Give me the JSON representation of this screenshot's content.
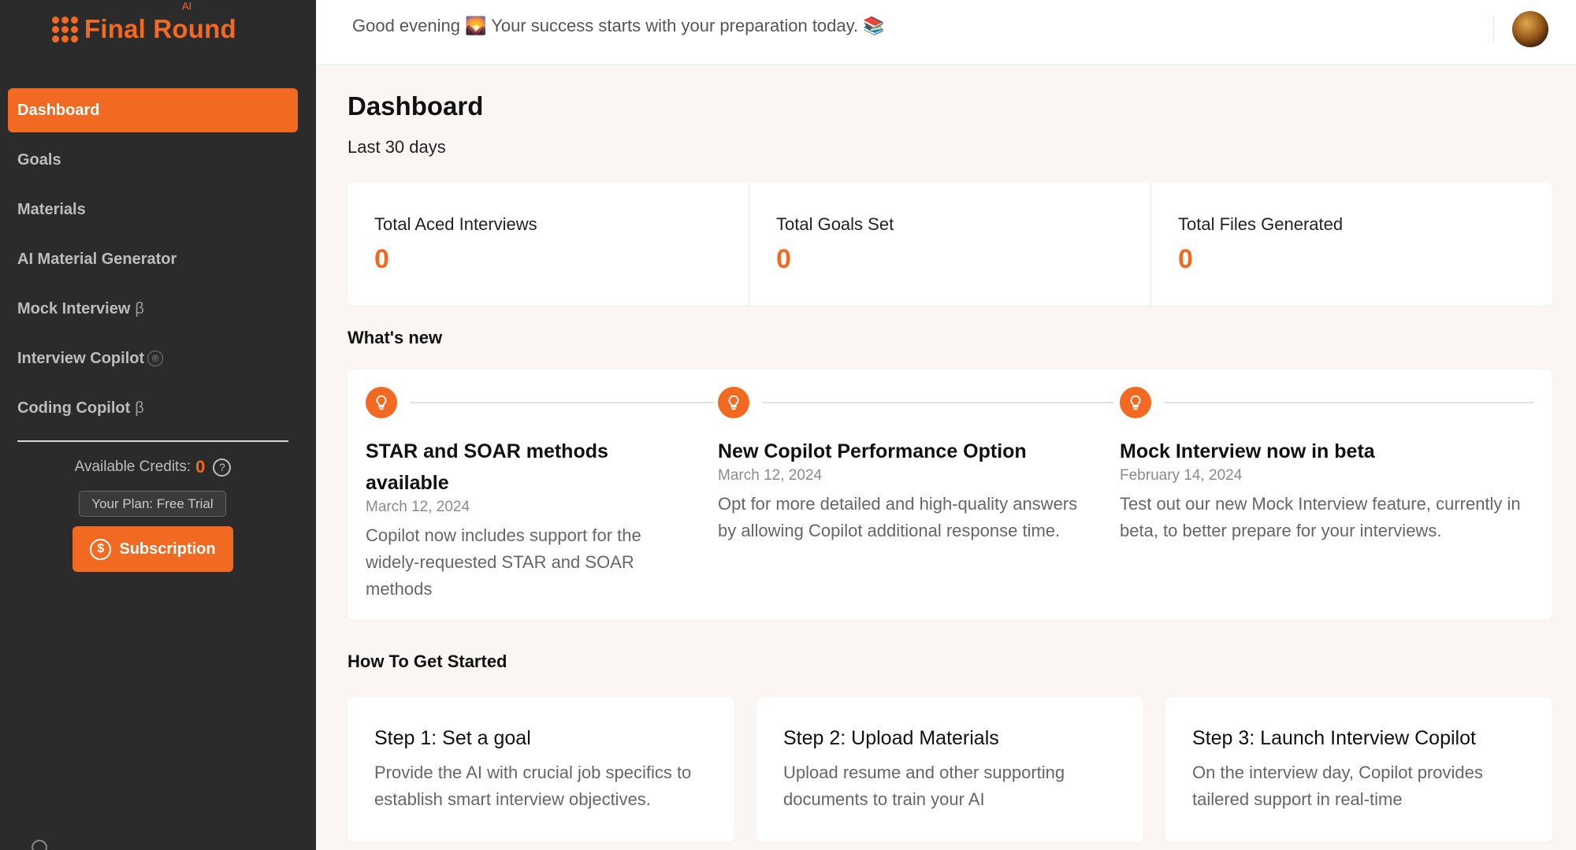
{
  "app": {
    "logo_text": "Final Round",
    "logo_badge": "AI"
  },
  "sidebar": {
    "items": [
      {
        "label": "Dashboard",
        "suffix": "",
        "active": true
      },
      {
        "label": "Goals",
        "suffix": ""
      },
      {
        "label": "Materials",
        "suffix": ""
      },
      {
        "label": "AI Material Generator",
        "suffix": ""
      },
      {
        "label": "Mock Interview",
        "suffix": "β"
      },
      {
        "label": "Interview Copilot",
        "suffix": "®"
      },
      {
        "label": "Coding Copilot",
        "suffix": "β"
      }
    ],
    "credits_label": "Available Credits:",
    "credits_value": "0",
    "plan_label": "Your Plan: Free Trial",
    "subscription_label": "Subscription"
  },
  "topbar": {
    "greeting": "Good evening 🌄 Your success starts with your preparation today. 📚"
  },
  "main": {
    "title": "Dashboard",
    "subtitle": "Last 30 days",
    "stats": [
      {
        "label": "Total Aced Interviews",
        "value": "0"
      },
      {
        "label": "Total Goals Set",
        "value": "0"
      },
      {
        "label": "Total Files Generated",
        "value": "0"
      }
    ],
    "whats_new_title": "What's new",
    "news": [
      {
        "title": "STAR and SOAR methods available",
        "date": "March 12, 2024",
        "text": "Copilot now includes support for the widely-requested STAR and SOAR methods"
      },
      {
        "title": "New Copilot Performance Option",
        "date": "March 12, 2024",
        "text": "Opt for more detailed and high-quality answers by allowing Copilot additional response time."
      },
      {
        "title": "Mock Interview now in beta",
        "date": "February 14, 2024",
        "text": "Test out our new Mock Interview feature, currently in beta, to better prepare for your interviews."
      }
    ],
    "get_started_title": "How To Get Started",
    "steps": [
      {
        "title": "Step 1: Set a goal",
        "text": "Provide the AI with crucial job specifics to establish smart interview objectives."
      },
      {
        "title": "Step 2: Upload Materials",
        "text": "Upload resume and other supporting documents to train your AI"
      },
      {
        "title": "Step 3: Launch Interview Copilot",
        "text": "On the interview day, Copilot provides tailered support in real-time"
      }
    ]
  },
  "colors": {
    "accent": "#f26a21",
    "sidebar_bg": "#2b2b2b",
    "page_bg": "#fbf6f3"
  },
  "icons": {
    "logo": "dots-grid-icon",
    "news": "lightbulb-icon",
    "help": "question-circle-icon",
    "subscription": "dollar-circle-icon"
  }
}
